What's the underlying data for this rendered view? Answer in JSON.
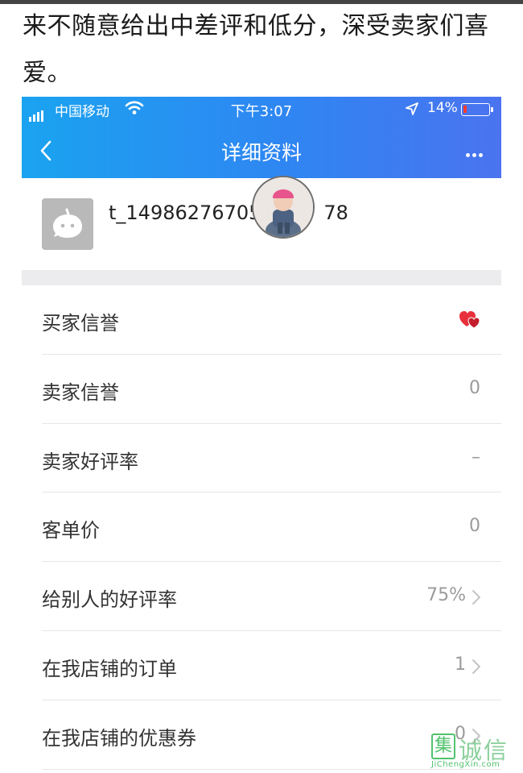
{
  "article": {
    "text": "来不随意给出中差评和低分，深受卖家们喜爱。"
  },
  "status_bar": {
    "carrier": "中国移动",
    "time": "下午3:07",
    "battery": "14%"
  },
  "nav": {
    "title": "详细资料",
    "back_icon": "chevron-left-icon",
    "more_icon": "more-dots-icon"
  },
  "profile": {
    "user_id": "t_14986276705",
    "user_id_suffix": "78"
  },
  "rows": [
    {
      "label": "买家信誉",
      "value": "",
      "icon": "red-hearts-icon"
    },
    {
      "label": "卖家信誉",
      "value": "0"
    },
    {
      "label": "卖家好评率",
      "value": "–"
    },
    {
      "label": "客单价",
      "value": "0"
    },
    {
      "label": "给别人的好评率",
      "value": "75%"
    },
    {
      "label": "在我店铺的订单",
      "value": "1"
    },
    {
      "label": "在我店铺的优惠券",
      "value": "0"
    }
  ],
  "watermark": {
    "char": "集",
    "text": "诚信",
    "sub": "JiChengXin.com"
  },
  "colors": {
    "nav_start": "#1aa3f0",
    "nav_end": "#4a73f0",
    "watermark": "#52c36e",
    "battery_low": "#ff3b30"
  }
}
